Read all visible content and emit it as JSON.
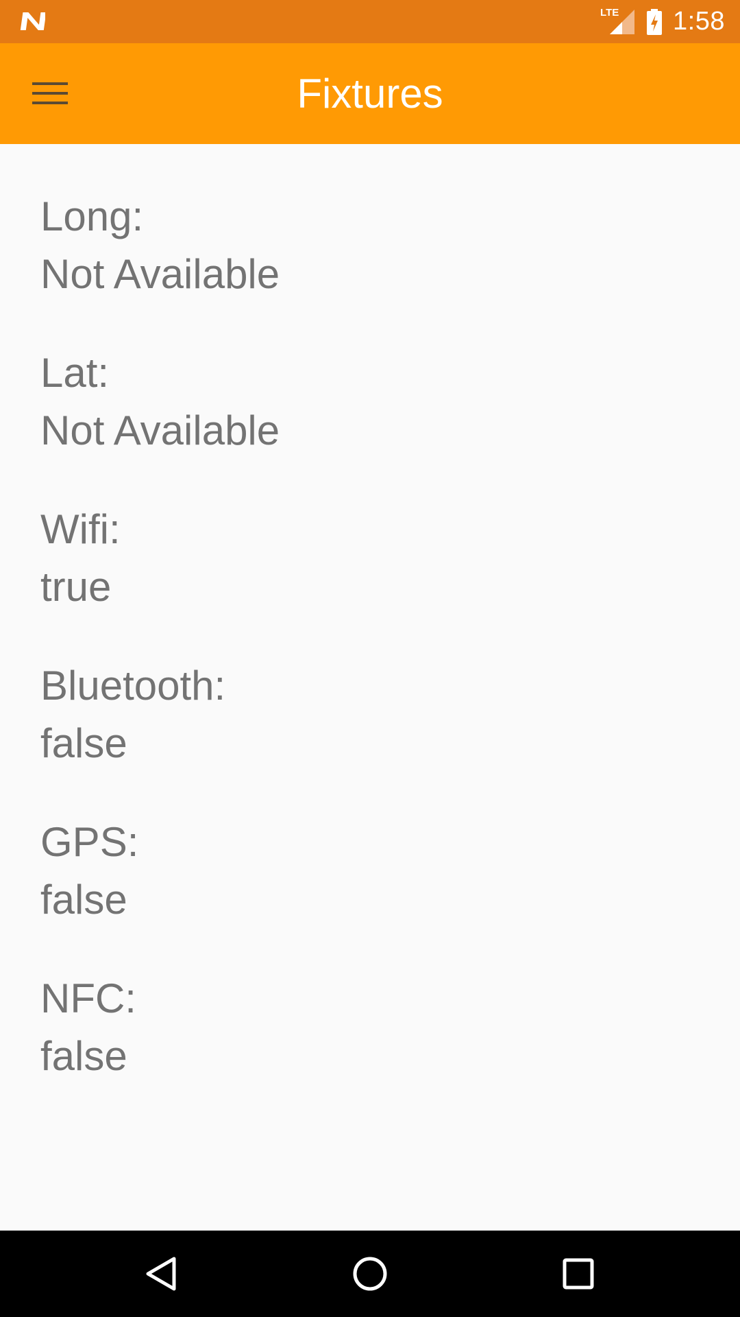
{
  "status_bar": {
    "time": "1:58",
    "network_label": "LTE",
    "bg_color": "#e47a14",
    "icons": [
      "n-notification-icon",
      "lte-signal-icon",
      "battery-charging-icon"
    ]
  },
  "app_bar": {
    "title": "Fixtures",
    "bg_color": "#ff9a04",
    "menu_icon": "hamburger-menu-icon"
  },
  "fields": [
    {
      "label": "Long:",
      "value": "Not Available"
    },
    {
      "label": "Lat:",
      "value": "Not Available"
    },
    {
      "label": "Wifi:",
      "value": "true"
    },
    {
      "label": "Bluetooth:",
      "value": "false"
    },
    {
      "label": "GPS:",
      "value": "false"
    },
    {
      "label": "NFC:",
      "value": "false"
    }
  ],
  "nav_bar": {
    "buttons": [
      "back-icon",
      "home-icon",
      "recents-icon"
    ]
  }
}
